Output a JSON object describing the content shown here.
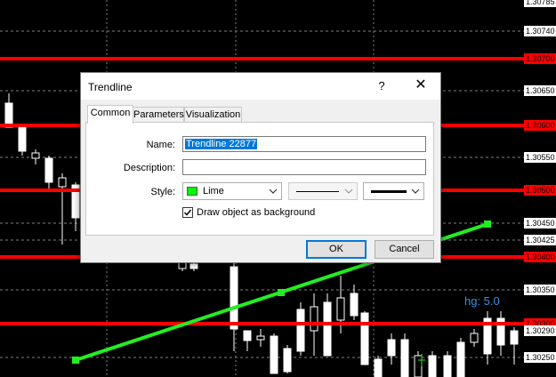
{
  "chart": {
    "price_labels": [
      {
        "text": "1.30785",
        "type": "normal"
      },
      {
        "text": "1.30740",
        "type": "normal"
      },
      {
        "text": "1.30700",
        "type": "red"
      },
      {
        "text": "1.30650",
        "type": "normal"
      },
      {
        "text": "1.30600",
        "type": "red"
      },
      {
        "text": "1.30550",
        "type": "normal"
      },
      {
        "text": "1.30500",
        "type": "red"
      },
      {
        "text": "1.30450",
        "type": "normal"
      },
      {
        "text": "1.30425",
        "type": "normal"
      },
      {
        "text": "1.30400",
        "type": "red"
      },
      {
        "text": "1.30350",
        "type": "normal"
      },
      {
        "text": "1.30300",
        "type": "red"
      },
      {
        "text": "1.30290",
        "type": "normal"
      },
      {
        "text": "1.30250",
        "type": "normal"
      }
    ],
    "annotation": "hg: 5.0",
    "colors": {
      "background": "#000000",
      "level_line": "#ff0000",
      "trendline": "#22ee22",
      "candle": "#ffffff",
      "grid": "#808080"
    }
  },
  "dialog": {
    "title": "Trendline",
    "help_label": "?",
    "close_label": "✕",
    "tabs": [
      "Common",
      "Parameters",
      "Visualization"
    ],
    "active_tab": "Common",
    "fields": {
      "name_label": "Name:",
      "name_value": "Trendline 22877",
      "description_label": "Description:",
      "description_value": "",
      "style_label": "Style:",
      "color_name": "Lime",
      "color_hex": "#00ff00"
    },
    "background_checkbox": {
      "label": "Draw object as background",
      "checked": true
    },
    "ok_label": "OK",
    "cancel_label": "Cancel"
  }
}
